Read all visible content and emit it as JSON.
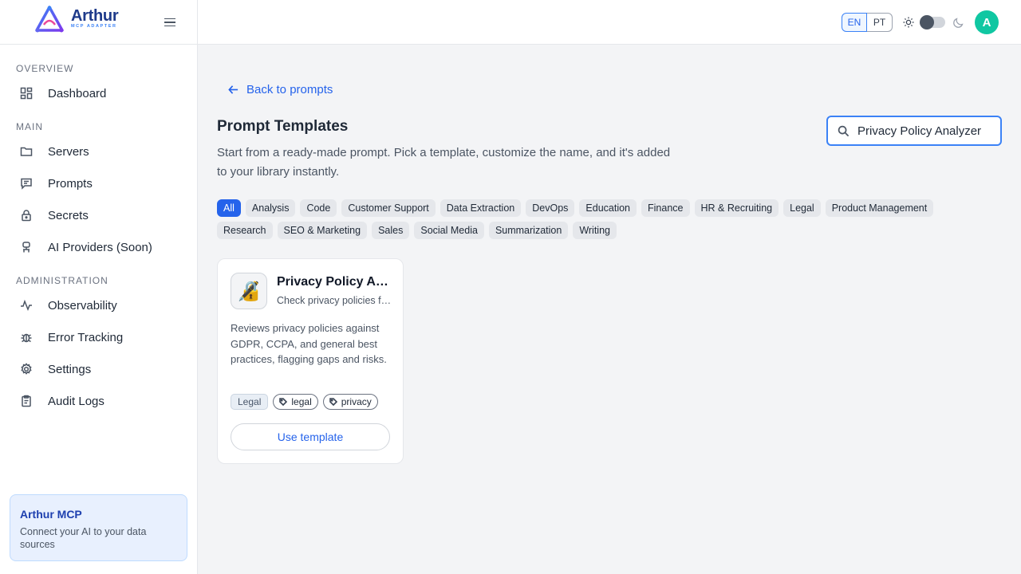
{
  "brand": {
    "name": "Arthur",
    "tagline": "MCP ADAPTER"
  },
  "sidebar": {
    "sections": [
      {
        "title": "OVERVIEW"
      },
      {
        "title": "MAIN"
      },
      {
        "title": "ADMINISTRATION"
      }
    ],
    "items": [
      {
        "label": "Dashboard",
        "icon": "dashboard-icon"
      },
      {
        "label": "Servers",
        "icon": "folder-icon"
      },
      {
        "label": "Prompts",
        "icon": "message-icon"
      },
      {
        "label": "Secrets",
        "icon": "lock-icon"
      },
      {
        "label": "AI Providers (Soon)",
        "icon": "robot-icon"
      },
      {
        "label": "Observability",
        "icon": "activity-icon"
      },
      {
        "label": "Error Tracking",
        "icon": "bug-icon"
      },
      {
        "label": "Settings",
        "icon": "gear-icon"
      },
      {
        "label": "Audit Logs",
        "icon": "clipboard-icon"
      }
    ],
    "promo": {
      "title": "Arthur MCP",
      "text": "Connect your AI to your data sources"
    }
  },
  "topbar": {
    "languages": [
      "EN",
      "PT"
    ],
    "selected_language": "EN",
    "theme": "light",
    "avatar_initial": "A"
  },
  "main": {
    "back_label": "Back to prompts",
    "title": "Prompt Templates",
    "description": "Start from a ready-made prompt. Pick a template, customize the name, and it's added to your library instantly.",
    "search": {
      "value": "Privacy Policy Analyzer"
    },
    "categories": [
      "All",
      "Analysis",
      "Code",
      "Customer Support",
      "Data Extraction",
      "DevOps",
      "Education",
      "Finance",
      "HR & Recruiting",
      "Legal",
      "Product Management",
      "Research",
      "SEO & Marketing",
      "Sales",
      "Social Media",
      "Summarization",
      "Writing"
    ],
    "active_category": "All",
    "cards": [
      {
        "icon": "🔏",
        "title": "Privacy Policy Analyzer",
        "subtitle": "Check privacy policies for compliance",
        "description": "Reviews privacy policies against GDPR, CCPA, and general best practices, flagging gaps and risks.",
        "category": "Legal",
        "tags": [
          "legal",
          "privacy"
        ],
        "button_label": "Use template"
      }
    ]
  },
  "colors": {
    "accent": "#2563eb",
    "avatar": "#10c7a2",
    "brand": "#1e3a8a"
  }
}
